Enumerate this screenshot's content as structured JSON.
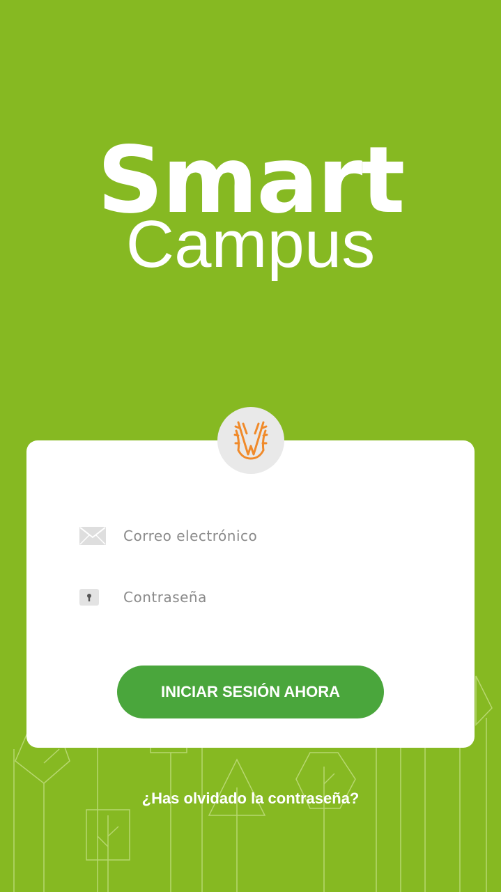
{
  "logo": {
    "line1": "Smart",
    "line2": "Campus"
  },
  "login": {
    "email_placeholder": "Correo electrónico",
    "password_placeholder": "Contraseña",
    "submit_label": "INICIAR SESIÓN AHORA",
    "forgot_label": "¿Has olvidado la contraseña?"
  },
  "icons": {
    "email": "mail-icon",
    "password": "lock-icon",
    "badge": "university-crest-icon"
  },
  "colors": {
    "background": "#86b922",
    "button": "#4aa63c",
    "card": "#ffffff",
    "badge": "#e9e9e9",
    "crest": "#f08a2a"
  }
}
